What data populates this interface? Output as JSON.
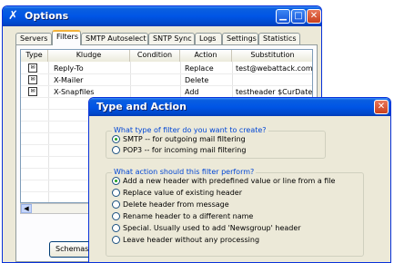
{
  "options_window": {
    "title": "Options",
    "tabs": [
      "Servers",
      "Filters",
      "SMTP Autoselect",
      "SNTP Sync",
      "Logs",
      "Settings",
      "Statistics"
    ],
    "active_tab": "Filters",
    "columns": [
      "Type",
      "Kludge",
      "Condition",
      "Action",
      "Substitution"
    ],
    "rows": [
      {
        "kludge": "Reply-To",
        "condition": "",
        "action": "Replace",
        "substitution": "test@webattack.com"
      },
      {
        "kludge": "X-Mailer",
        "condition": "",
        "action": "Delete",
        "substitution": ""
      },
      {
        "kludge": "X-Snapfiles",
        "condition": "",
        "action": "Add",
        "substitution": "testheader $CurDate()"
      }
    ],
    "schemas_button": "Schemas..."
  },
  "dialog": {
    "title": "Type and Action",
    "filter_group": {
      "legend": "What type of filter do you want to create?",
      "options": [
        {
          "label": "SMTP -- for outgoing mail filtering",
          "selected": true
        },
        {
          "label": "POP3 -- for incoming mail filtering",
          "selected": false
        }
      ]
    },
    "action_group": {
      "legend": "What action should this filter perform?",
      "options": [
        {
          "label": "Add a new header with predefined value or line from a file",
          "selected": true
        },
        {
          "label": "Replace value of existing header",
          "selected": false
        },
        {
          "label": "Delete header from message",
          "selected": false
        },
        {
          "label": "Rename header to a different name",
          "selected": false
        },
        {
          "label": "Special. Usually used to add 'Newsgroup' header",
          "selected": false
        },
        {
          "label": "Leave header without any processing",
          "selected": false
        }
      ]
    }
  },
  "colors": {
    "titlebar": "#0055e5",
    "close": "#c9401d",
    "dialog_bg": "#ece9d8",
    "legend": "#0046d5"
  }
}
